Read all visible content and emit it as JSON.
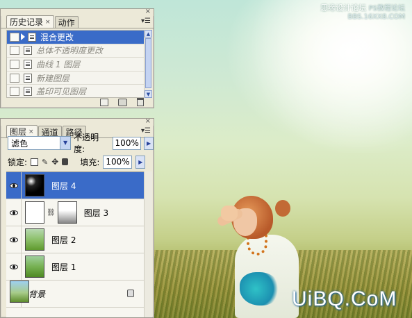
{
  "watermark_top": {
    "line1": "思缘设计论坛",
    "line2": "PS教程论坛",
    "line3": "BBS.16XX8.COM"
  },
  "watermark_bottom": "UiBQ.CoM",
  "history_panel": {
    "tabs": [
      {
        "label": "历史记录",
        "close": "×"
      },
      {
        "label": "动作"
      }
    ],
    "items": [
      {
        "label": "混合更改",
        "selected": true
      },
      {
        "label": "总体不透明度更改",
        "selected": false
      },
      {
        "label": "曲线 1 图层",
        "selected": false
      },
      {
        "label": "新建图层",
        "selected": false
      },
      {
        "label": "盖印可见图层",
        "selected": false
      }
    ]
  },
  "layers_panel": {
    "tabs": [
      {
        "label": "图层",
        "close": "×"
      },
      {
        "label": "通道"
      },
      {
        "label": "路径"
      }
    ],
    "blend_mode": "滤色",
    "opacity_label": "不透明度:",
    "opacity_value": "100%",
    "lock_label": "锁定:",
    "fill_label": "填充:",
    "fill_value": "100%",
    "layers": [
      {
        "name": "图层 4",
        "selected": true
      },
      {
        "name": "图层 3",
        "selected": false
      },
      {
        "name": "图层 2",
        "selected": false
      },
      {
        "name": "图层 1",
        "selected": false
      },
      {
        "name": "背景",
        "selected": false
      }
    ]
  },
  "colors": {
    "selection": "#3a6bc8",
    "panel_bg": "#ece9d8",
    "watermark": "#ffffff"
  }
}
